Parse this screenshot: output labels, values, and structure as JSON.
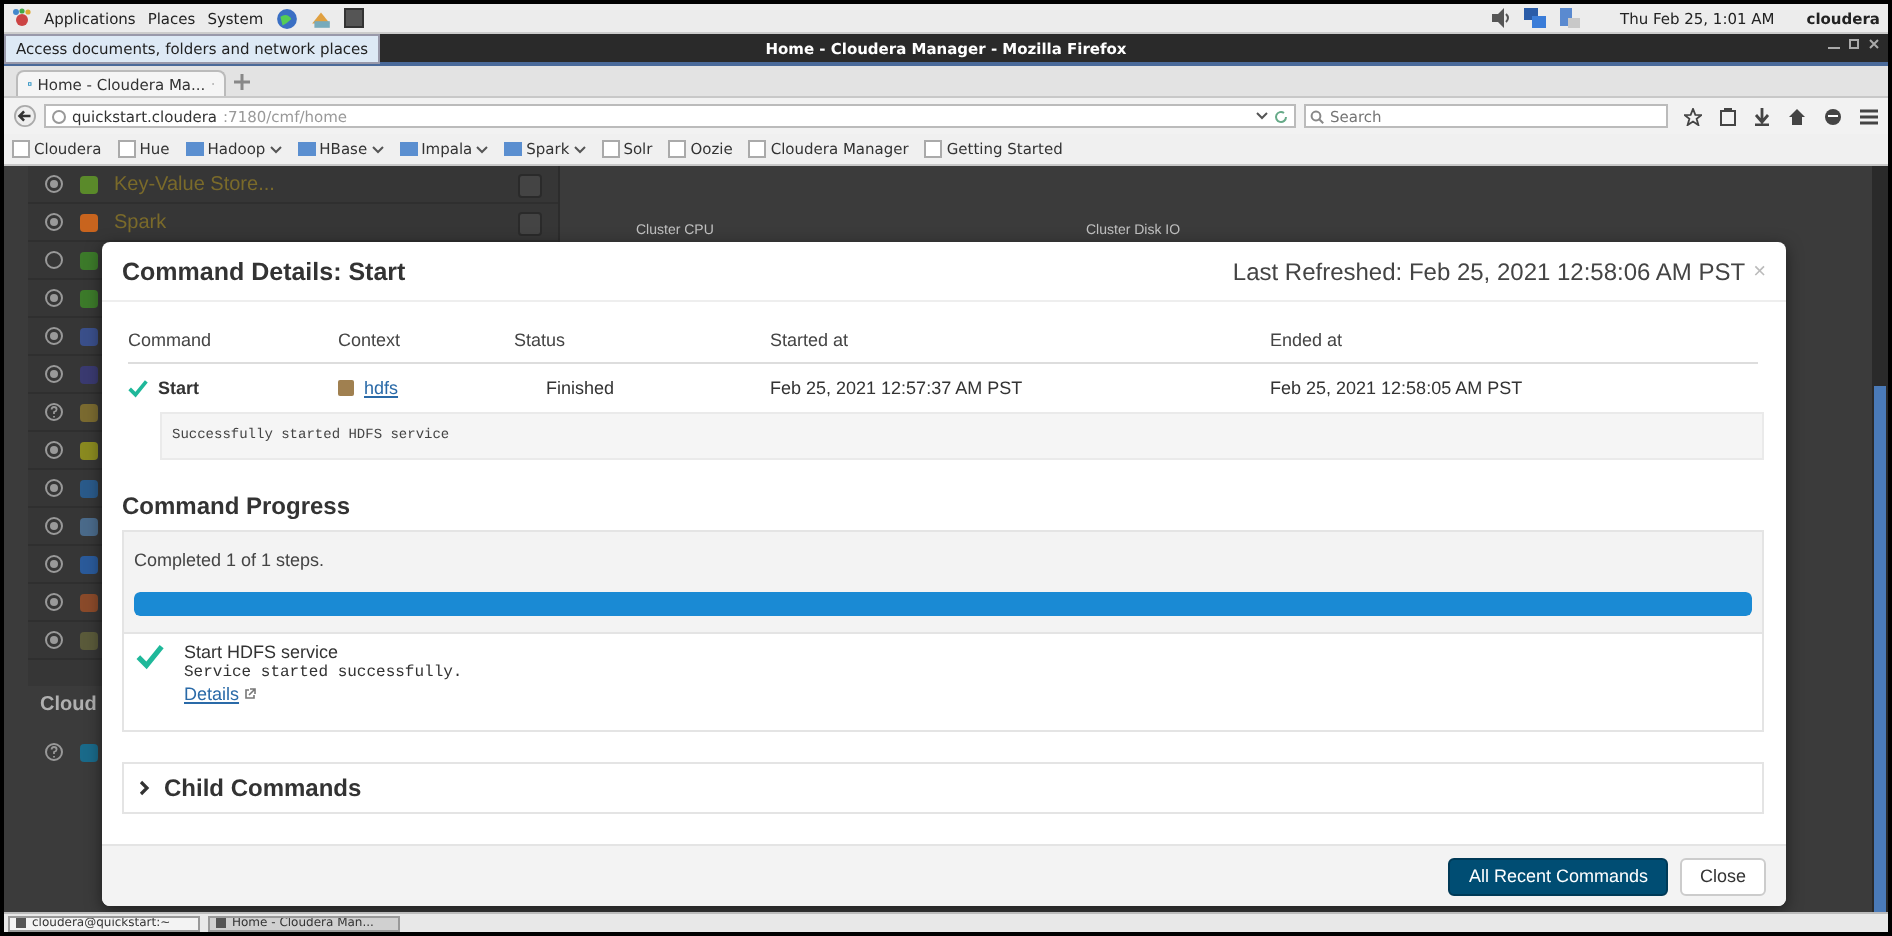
{
  "top_panel": {
    "menus": [
      "Applications",
      "Places",
      "System"
    ],
    "clock": "Thu Feb 25,  1:01 AM",
    "user": "cloudera"
  },
  "tooltip": "Access documents, folders and network places",
  "window": {
    "title": "Home - Cloudera Manager - Mozilla Firefox"
  },
  "tabs": [
    {
      "label": "Home - Cloudera Ma...",
      "selected": true
    }
  ],
  "address_bar": {
    "host": "quickstart.cloudera",
    "path": ":7180/cmf/home"
  },
  "search": {
    "placeholder": "Search"
  },
  "bookmarks": [
    {
      "label": "Cloudera",
      "kind": "page"
    },
    {
      "label": "Hue",
      "kind": "page"
    },
    {
      "label": "Hadoop",
      "kind": "folder"
    },
    {
      "label": "HBase",
      "kind": "folder"
    },
    {
      "label": "Impala",
      "kind": "folder"
    },
    {
      "label": "Spark",
      "kind": "folder"
    },
    {
      "label": "Solr",
      "kind": "page"
    },
    {
      "label": "Oozie",
      "kind": "page"
    },
    {
      "label": "Cloudera Manager",
      "kind": "page"
    },
    {
      "label": "Getting Started",
      "kind": "page"
    }
  ],
  "background_page": {
    "services": [
      {
        "name": "Key-Value Store...",
        "kind": "filled",
        "color": "#5a8a2a"
      },
      {
        "name": "Spark",
        "kind": "filled",
        "color": "#c8641e"
      },
      {
        "kind": "empty",
        "color": "#3c7a2a"
      },
      {
        "kind": "filled",
        "color": "#3c7a2a"
      },
      {
        "kind": "filled",
        "color": "#3a4f8a"
      },
      {
        "kind": "filled",
        "color": "#3a3a70"
      },
      {
        "kind": "help",
        "color": "#7a6a30"
      },
      {
        "kind": "filled",
        "color": "#8a8a20"
      },
      {
        "kind": "filled",
        "color": "#2a5a8a"
      },
      {
        "kind": "filled",
        "color": "#4a6a8a"
      },
      {
        "kind": "filled",
        "color": "#2a5a9a"
      },
      {
        "kind": "filled",
        "color": "#8a4a2a"
      },
      {
        "kind": "filled",
        "color": "#5a5a3a"
      }
    ],
    "chart_titles": [
      "Cluster CPU",
      "Cluster Disk IO"
    ],
    "section_heading": "Cloud",
    "section_services": [
      {
        "kind": "help",
        "color": "#1a6a8a"
      }
    ]
  },
  "dialog": {
    "title": "Command Details: Start",
    "last_refreshed": "Last Refreshed: Feb 25, 2021 12:58:06 AM PST",
    "close": "×",
    "table": {
      "columns": [
        "Command",
        "Context",
        "Status",
        "Started at",
        "Ended at"
      ],
      "rows": [
        {
          "succeeded": true,
          "command": "Start",
          "context": "hdfs",
          "status": "Finished",
          "started_at": "Feb 25, 2021 12:57:37 AM PST",
          "ended_at": "Feb 25, 2021 12:58:05 AM PST",
          "message": "Successfully started HDFS service"
        }
      ]
    },
    "progress": {
      "heading": "Command Progress",
      "summary": "Completed 1 of 1 steps.",
      "level": 1,
      "steps": [
        {
          "succeeded": true,
          "title": "Start HDFS service",
          "message": "Service started successfully.",
          "link": "Details"
        }
      ]
    },
    "child_commands": {
      "label": "Child Commands",
      "expanded": false
    },
    "buttons": [
      {
        "label": "All Recent Commands",
        "kind": "primary"
      },
      {
        "label": "Close",
        "kind": "default"
      }
    ]
  },
  "taskbar": [
    {
      "label": "cloudera@quickstart:~",
      "selected": false
    },
    {
      "label": "Home - Cloudera Man...",
      "selected": true
    }
  ]
}
